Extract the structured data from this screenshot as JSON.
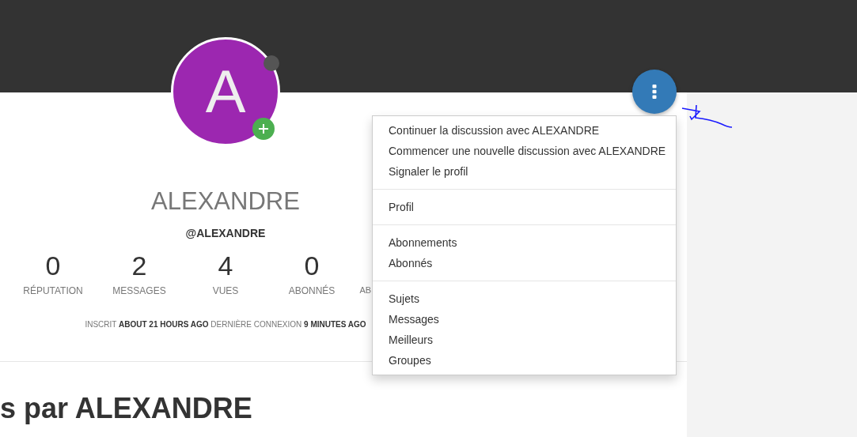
{
  "profile": {
    "avatar_letter": "A",
    "display_name": "ALEXANDRE",
    "username": "@ALEXANDRE",
    "stats": [
      {
        "value": "0",
        "label": "RÉPUTATION"
      },
      {
        "value": "2",
        "label": "MESSAGES"
      },
      {
        "value": "4",
        "label": "VUES"
      },
      {
        "value": "0",
        "label": "ABONNÉS"
      },
      {
        "label": "AB"
      }
    ],
    "joined_label": "INSCRIT",
    "joined_value": "ABOUT 21 HOURS AGO",
    "last_seen_label": "DERNIÈRE CONNEXION",
    "last_seen_value": "9 MINUTES AGO"
  },
  "section_heading": "s par ALEXANDRE",
  "menu": {
    "sections": [
      [
        "Continuer la discussion avec ALEXANDRE",
        "Commencer une nouvelle discussion avec ALEXANDRE",
        "Signaler le profil"
      ],
      [
        "Profil"
      ],
      [
        "Abonnements",
        "Abonnés"
      ],
      [
        "Sujets",
        "Messages",
        "Meilleurs",
        "Groupes"
      ]
    ]
  }
}
